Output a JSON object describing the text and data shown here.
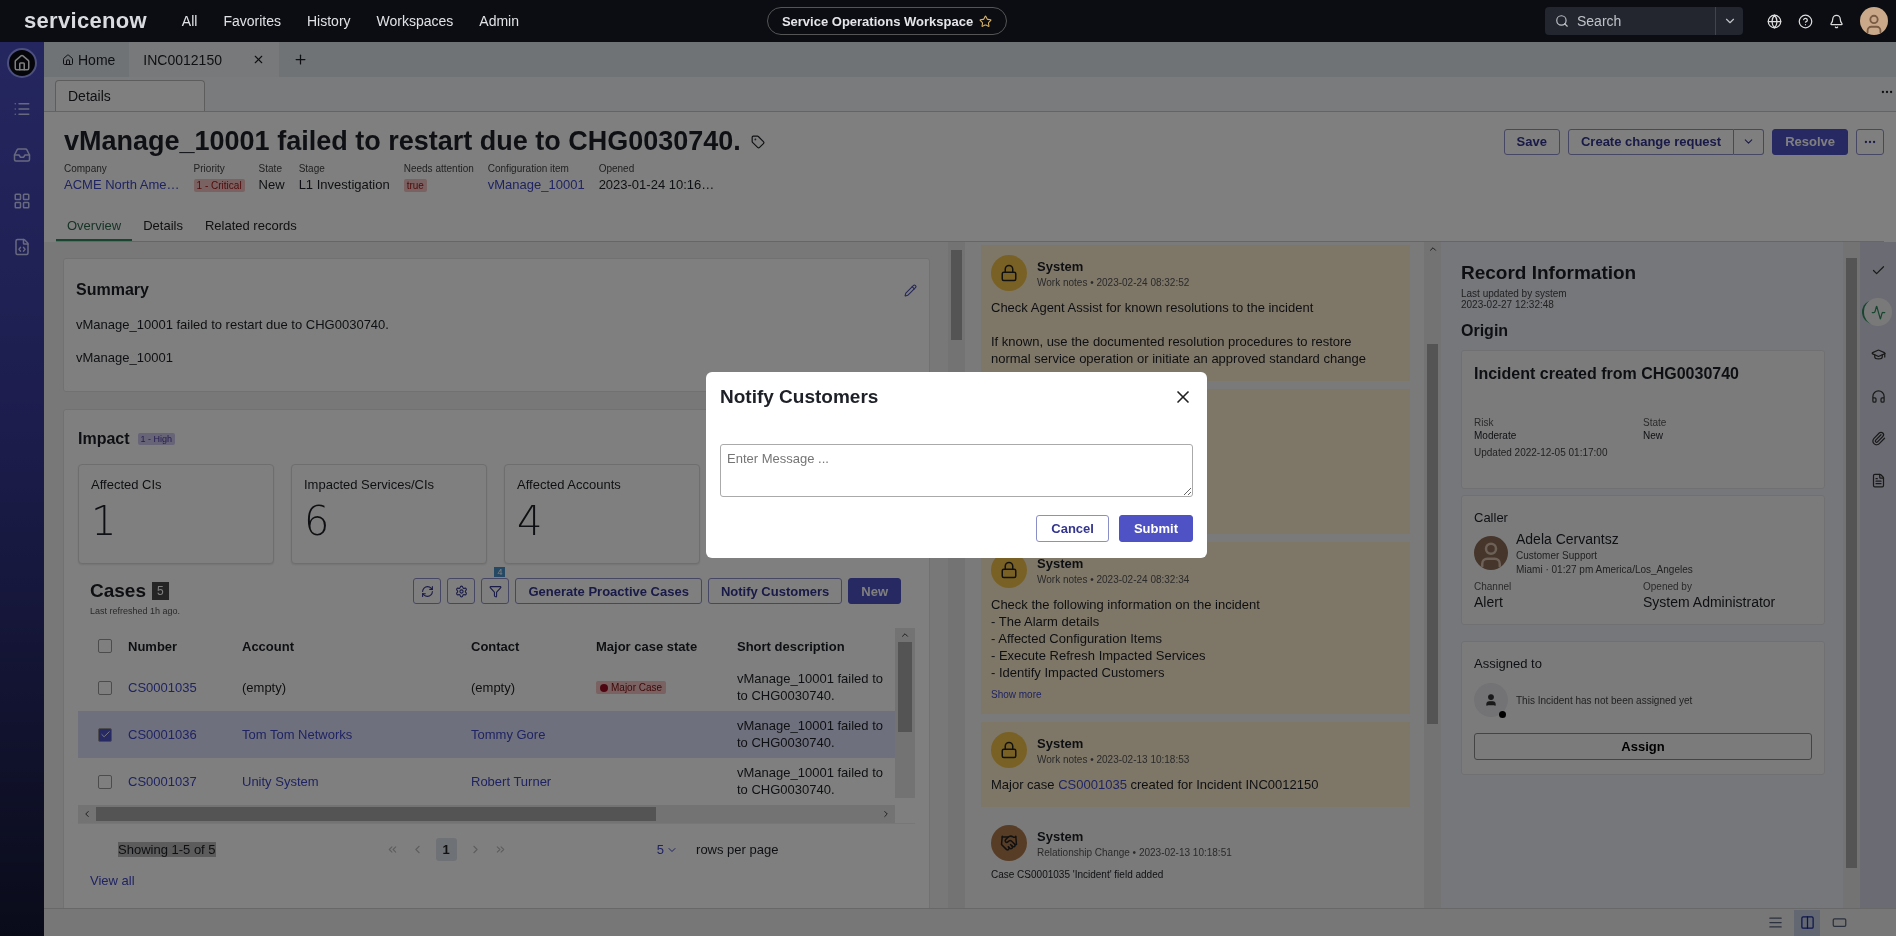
{
  "topbar": {
    "logo": "servicenow",
    "nav": [
      "All",
      "Favorites",
      "History",
      "Workspaces",
      "Admin"
    ],
    "workspace": "Service Operations Workspace",
    "search": {
      "placeholder": "Search"
    }
  },
  "left_rail": [
    {
      "kind": "home",
      "selected": true
    },
    {
      "kind": "list",
      "selected": false
    },
    {
      "kind": "inbox",
      "selected": false
    },
    {
      "kind": "grid",
      "selected": false
    },
    {
      "kind": "code",
      "selected": false
    }
  ],
  "tabs": [
    {
      "kind": "home",
      "label": "Home",
      "selected": false
    },
    {
      "kind": "record",
      "label": "INC0012150",
      "selected": true
    }
  ],
  "subtabs": [
    {
      "label": "Details",
      "selected": true
    }
  ],
  "record": {
    "title": "vManage_10001 failed to restart due to CHG0030740.",
    "fields": [
      {
        "label": "Company",
        "value": "ACME North Ame…",
        "kind": "link"
      },
      {
        "label": "Priority",
        "value": "1 - Critical",
        "kind": "badge"
      },
      {
        "label": "State",
        "value": "New",
        "kind": "text"
      },
      {
        "label": "Stage",
        "value": "L1 Investigation",
        "kind": "text"
      },
      {
        "label": "Needs attention",
        "value": "true",
        "kind": "badge"
      },
      {
        "label": "Configuration item",
        "value": "vManage_10001",
        "kind": "link"
      },
      {
        "label": "Opened",
        "value": "2023-01-24 10:16…",
        "kind": "text"
      }
    ],
    "actions": [
      {
        "label": "Save",
        "kind": "secondary"
      },
      {
        "label": "Create change request",
        "kind": "split"
      },
      {
        "label": "Resolve",
        "kind": "primary"
      }
    ]
  },
  "view_tabs": [
    {
      "label": "Overview",
      "selected": true
    },
    {
      "label": "Details",
      "selected": false
    },
    {
      "label": "Related records",
      "selected": false
    }
  ],
  "summary": {
    "title": "Summary",
    "lines": [
      "vManage_10001 failed to restart due to CHG0030740.",
      "vManage_10001"
    ]
  },
  "impact": {
    "title": "Impact",
    "badge": "1 - High",
    "cards": [
      {
        "label": "Affected CIs",
        "value": "1"
      },
      {
        "label": "Impacted Services/CIs",
        "value": "6"
      },
      {
        "label": "Affected Accounts",
        "value": "4"
      }
    ]
  },
  "cases": {
    "title": "Cases",
    "count": "5",
    "refreshed": "Last refreshed 1h ago.",
    "filter_count": "4",
    "buttons": [
      {
        "label": "Generate Proactive Cases",
        "kind": "secondary"
      },
      {
        "label": "Notify Customers",
        "kind": "secondary"
      },
      {
        "label": "New",
        "kind": "primary"
      }
    ],
    "select_all": {
      "checked": false
    },
    "columns": [
      "Number",
      "Account",
      "Contact",
      "Major case state",
      "Short description"
    ],
    "rows": [
      {
        "selected": false,
        "number": "CS0001035",
        "account": {
          "text": "(empty)",
          "link": false
        },
        "contact": {
          "text": "(empty)",
          "link": false
        },
        "state": "Major Case",
        "description": "vManage_10001 failed to\nto CHG0030740."
      },
      {
        "selected": true,
        "number": "CS0001036",
        "account": {
          "text": "Tom Tom Networks",
          "link": true
        },
        "contact": {
          "text": "Tommy Gore",
          "link": true
        },
        "description": "vManage_10001 failed to\nto CHG0030740."
      },
      {
        "selected": false,
        "number": "CS0001037",
        "account": {
          "text": "Unity System",
          "link": true
        },
        "contact": {
          "text": "Robert Turner",
          "link": true
        },
        "description": "vManage_10001 failed to\nto CHG0030740."
      }
    ],
    "showing": "Showing 1-5 of 5",
    "page": "1",
    "rows_per_page": "5",
    "rows_per_page_label": "rows per page",
    "view_all": "View all"
  },
  "timeline": [
    {
      "kind": "work_note",
      "author": "System",
      "meta": "Work notes • 2023-02-24 08:32:52",
      "body": "Check Agent Assist for known resolutions to the incident\n\nIf known, use the documented resolution procedures to restore\nnormal service operation or initiate an approved standard change"
    },
    {
      "kind": "work_note"
    },
    {
      "kind": "work_note",
      "author": "System",
      "meta": "Work notes • 2023-02-24 08:32:34",
      "body": "Check the following information on the incident\n- The Alarm details\n- Affected Configuration Items\n- Execute Refresh Impacted Services\n- Identify Impacted Customers",
      "more": "Show more"
    },
    {
      "kind": "work_note",
      "author": "System",
      "meta": "Work notes • 2023-02-13 10:18:53",
      "parts": {
        "before": "Major case ",
        "link": "CS0001035",
        "after": " created for Incident INC0012150"
      }
    },
    {
      "kind": "relationship",
      "author": "System",
      "meta": "Relationship Change • 2023-02-13 10:18:51",
      "small": "Case CS0001035 'Incident' field added"
    }
  ],
  "record_info": {
    "title": "Record Information",
    "updated_by": "Last updated by system",
    "updated_at": "2023-02-27 12:32:48",
    "origin": "Origin",
    "origin_card": {
      "title": "Incident created from CHG0030740",
      "fields": [
        {
          "label": "Risk",
          "value": "Moderate"
        },
        {
          "label": "State",
          "value": "New"
        }
      ],
      "updated": "Updated 2022-12-05 01:17:00"
    },
    "caller": {
      "heading": "Caller",
      "name": "Adela Cervantsz",
      "role": "Customer Support",
      "location": "Miami · 01:27 pm America/Los_Angeles",
      "fields": [
        {
          "label": "Channel",
          "value": "Alert"
        },
        {
          "label": "Opened by",
          "value": "System Administrator"
        }
      ]
    },
    "assigned": {
      "heading": "Assigned to",
      "note": "This Incident has not been assigned yet",
      "button": "Assign"
    }
  },
  "right_rail": [
    {
      "kind": "check",
      "selected": false
    },
    {
      "kind": "activity",
      "selected": true
    },
    {
      "kind": "cap",
      "selected": false
    },
    {
      "kind": "headset",
      "selected": false
    },
    {
      "kind": "clip",
      "selected": false
    },
    {
      "kind": "doc",
      "selected": false
    }
  ],
  "layout_buttons": [
    {
      "kind": "rows",
      "selected": false
    },
    {
      "kind": "split",
      "selected": true
    },
    {
      "kind": "single",
      "selected": false
    }
  ],
  "modal": {
    "title": "Notify Customers",
    "placeholder": "Enter Message ...",
    "buttons": [
      {
        "label": "Cancel",
        "kind": "secondary"
      },
      {
        "label": "Submit",
        "kind": "primary"
      }
    ]
  }
}
